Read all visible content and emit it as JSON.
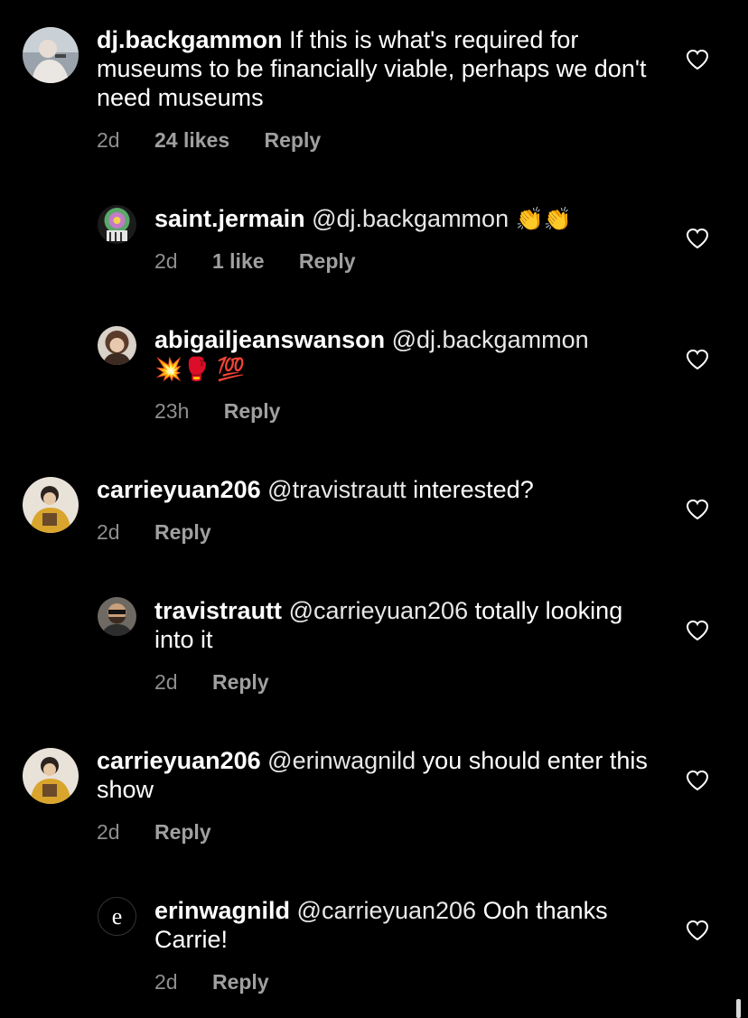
{
  "comments": [
    {
      "username": "dj.backgammon",
      "text": "If this is what's required for museums to be financially viable, perhaps we don't need museums",
      "time": "2d",
      "likes": "24 likes",
      "reply_label": "Reply"
    },
    {
      "username": "saint.jermain",
      "mention": "@dj.backgammon",
      "text": "",
      "emoji": "👏👏",
      "time": "2d",
      "likes": "1 like",
      "reply_label": "Reply"
    },
    {
      "username": "abigailjeanswanson",
      "mention": "@dj.backgammon",
      "emoji": "💥🥊 💯",
      "time": "23h",
      "reply_label": "Reply"
    },
    {
      "username": "carrieyuan206",
      "mention": "@travistrautt",
      "text": "interested?",
      "time": "2d",
      "reply_label": "Reply"
    },
    {
      "username": "travistrautt",
      "mention": "@carrieyuan206",
      "text": "totally looking into it",
      "time": "2d",
      "reply_label": "Reply"
    },
    {
      "username": "carrieyuan206",
      "mention": "@erinwagnild",
      "text": "you should enter this show",
      "time": "2d",
      "reply_label": "Reply"
    },
    {
      "username": "erinwagnild",
      "avatar_letter": "e",
      "mention": "@carrieyuan206",
      "text": "Ooh thanks Carrie!",
      "time": "2d",
      "reply_label": "Reply"
    }
  ],
  "colors": {
    "background": "#000000",
    "text": "#ffffff",
    "meta": "#8e8e8e"
  },
  "icons": {
    "like": "heart-outline-icon"
  }
}
